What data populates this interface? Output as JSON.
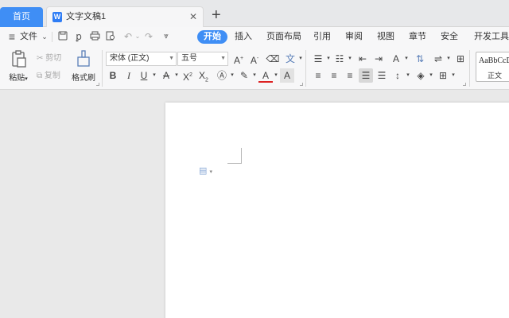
{
  "tabs": {
    "home_label": "首页",
    "doc_title": "文字文稿1",
    "doc_icon_letter": "W",
    "close_glyph": "✕",
    "new_tab_glyph": "+"
  },
  "menu": {
    "file_label": "文件",
    "items": [
      "开始",
      "插入",
      "页面布局",
      "引用",
      "审阅",
      "视图",
      "章节",
      "安全",
      "开发工具"
    ]
  },
  "ribbon": {
    "paste_label": "粘贴",
    "cut_label": "剪切",
    "copy_label": "复制",
    "format_painter_label": "格式刷",
    "font_name": "宋体 (正文)",
    "font_size": "五号",
    "style_preview": "AaBbCcDd",
    "style_name": "正文"
  },
  "colors": {
    "accent": "#3f8ef5",
    "tab_bar_bg": "#e7e8ea",
    "ribbon_bg": "#f7f7f8",
    "workspace_bg": "#e9e9e9",
    "page_bg": "#ffffff"
  }
}
